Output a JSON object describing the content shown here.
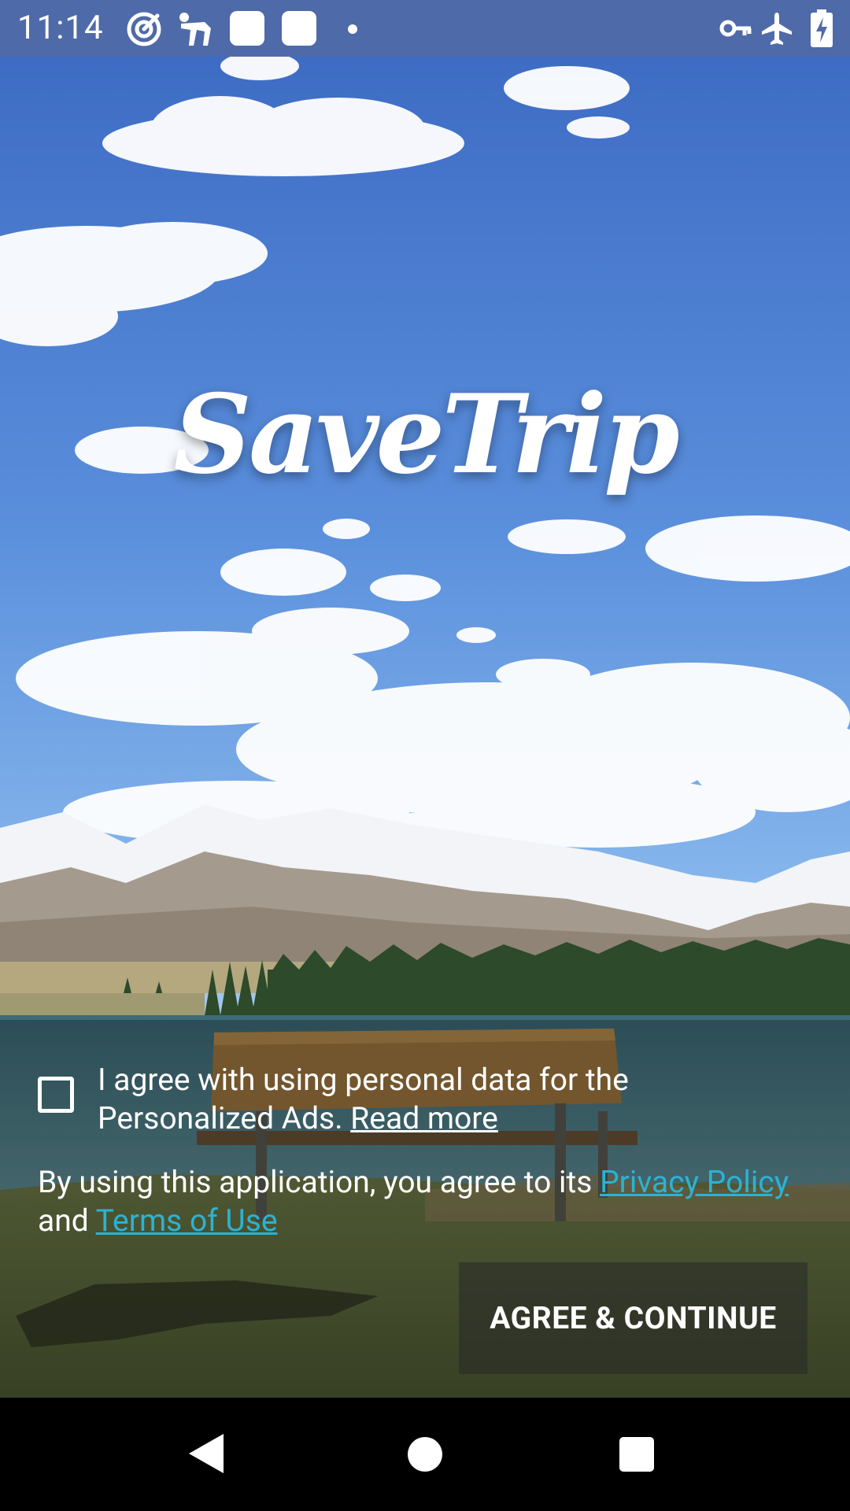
{
  "status_bar": {
    "time": "11:14",
    "left_icons": [
      "target-app-icon",
      "runner-app-icon",
      "app-square-icon",
      "app-square-icon",
      "notification-dot-icon"
    ],
    "right_icons": [
      "vpn-key-icon",
      "airplane-mode-icon",
      "battery-charging-icon"
    ]
  },
  "logo": {
    "text": "SaveTrip"
  },
  "consent": {
    "checkbox_checked": false,
    "text": "I agree with using personal data for the Personalized Ads. ",
    "read_more": "Read more"
  },
  "terms": {
    "prefix": "By using this application, you agree to its ",
    "privacy_policy": "Privacy Policy",
    "conjunction": " and ",
    "terms_of_use": "Terms of Use"
  },
  "actions": {
    "agree_label": "AGREE & CONTINUE"
  },
  "nav_bar": {
    "buttons": [
      "back-icon",
      "home-icon",
      "recents-icon"
    ]
  },
  "colors": {
    "status_bar_bg": "#4f6aa8",
    "link_teal": "#2ab3d4",
    "button_bg": "rgba(40,40,40,0.55)"
  }
}
